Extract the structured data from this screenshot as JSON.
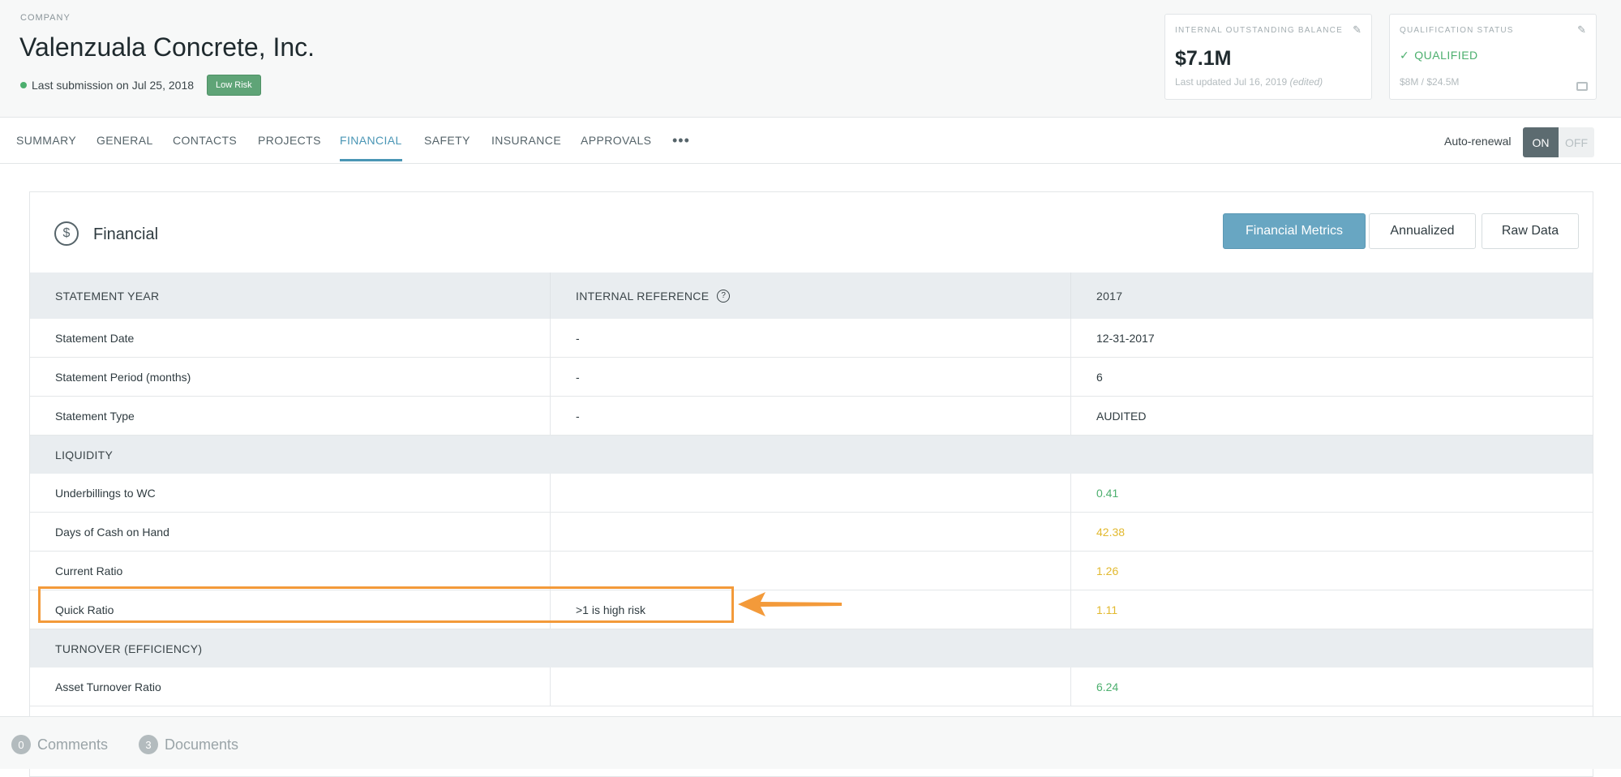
{
  "header": {
    "company_label": "COMPANY",
    "company_name": "Valenzuala Concrete, Inc.",
    "submission_text": "Last submission on Jul 25, 2018",
    "risk_badge": "Low Risk",
    "balance_card": {
      "label": "INTERNAL OUTSTANDING BALANCE",
      "value": "$7.1M",
      "updated": "Last updated Jul 16, 2019",
      "edited": "(edited)"
    },
    "qualification_card": {
      "label": "QUALIFICATION STATUS",
      "status": "QUALIFIED",
      "range": "$8M / $24.5M"
    }
  },
  "tabs": {
    "items": [
      "SUMMARY",
      "GENERAL",
      "CONTACTS",
      "PROJECTS",
      "FINANCIAL",
      "SAFETY",
      "INSURANCE",
      "APPROVALS"
    ],
    "active": "FINANCIAL",
    "more": "•••",
    "auto_renewal_label": "Auto-renewal",
    "toggle_on": "ON",
    "toggle_off": "OFF"
  },
  "financial": {
    "title": "Financial",
    "buttons": [
      "Financial Metrics",
      "Annualized",
      "Raw Data"
    ],
    "table": {
      "headers": [
        "STATEMENT YEAR",
        "INTERNAL REFERENCE",
        "2017"
      ],
      "rows": [
        {
          "label": "Statement Date",
          "ref": "-",
          "value": "12-31-2017"
        },
        {
          "label": "Statement Period (months)",
          "ref": "-",
          "value": "6"
        },
        {
          "label": "Statement Type",
          "ref": "-",
          "value": "AUDITED"
        }
      ],
      "liquidity_section": "LIQUIDITY",
      "liquidity_rows": [
        {
          "label": "Underbillings to WC",
          "ref": "",
          "value": "0.41"
        },
        {
          "label": "Days of Cash on Hand",
          "ref": "",
          "value": "42.38"
        },
        {
          "label": "Current Ratio",
          "ref": "",
          "value": "1.26"
        },
        {
          "label": "Quick Ratio",
          "ref": ">1 is high risk",
          "value": "1.11"
        }
      ],
      "turnover_section": "TURNOVER (EFFICIENCY)",
      "turnover_rows": [
        {
          "label": "Asset Turnover Ratio",
          "ref": "",
          "value": "6.24"
        }
      ]
    }
  },
  "footer": {
    "comments_count": "0",
    "comments_label": "Comments",
    "documents_count": "3",
    "documents_label": "Documents"
  },
  "colors": {
    "accent": "#4a96b5",
    "good": "#4caf6e",
    "warning": "#e2b92e",
    "highlight": "#f39a3a"
  }
}
